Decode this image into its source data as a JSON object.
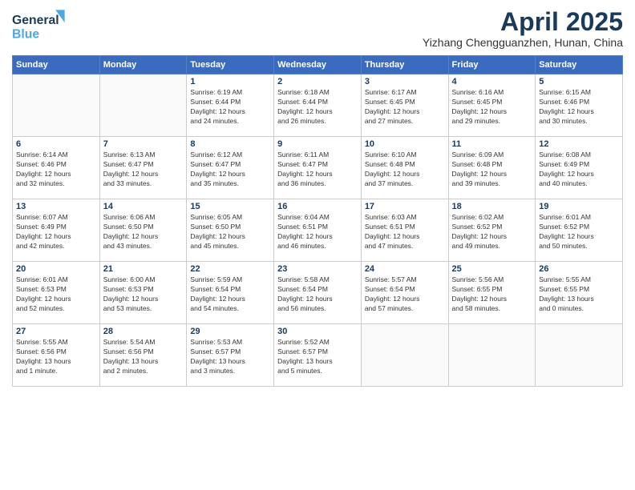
{
  "header": {
    "logo_general": "General",
    "logo_blue": "Blue",
    "month_title": "April 2025",
    "location": "Yizhang Chengguanzhen, Hunan, China"
  },
  "weekdays": [
    "Sunday",
    "Monday",
    "Tuesday",
    "Wednesday",
    "Thursday",
    "Friday",
    "Saturday"
  ],
  "weeks": [
    [
      {
        "num": "",
        "info": ""
      },
      {
        "num": "",
        "info": ""
      },
      {
        "num": "1",
        "info": "Sunrise: 6:19 AM\nSunset: 6:44 PM\nDaylight: 12 hours\nand 24 minutes."
      },
      {
        "num": "2",
        "info": "Sunrise: 6:18 AM\nSunset: 6:44 PM\nDaylight: 12 hours\nand 26 minutes."
      },
      {
        "num": "3",
        "info": "Sunrise: 6:17 AM\nSunset: 6:45 PM\nDaylight: 12 hours\nand 27 minutes."
      },
      {
        "num": "4",
        "info": "Sunrise: 6:16 AM\nSunset: 6:45 PM\nDaylight: 12 hours\nand 29 minutes."
      },
      {
        "num": "5",
        "info": "Sunrise: 6:15 AM\nSunset: 6:46 PM\nDaylight: 12 hours\nand 30 minutes."
      }
    ],
    [
      {
        "num": "6",
        "info": "Sunrise: 6:14 AM\nSunset: 6:46 PM\nDaylight: 12 hours\nand 32 minutes."
      },
      {
        "num": "7",
        "info": "Sunrise: 6:13 AM\nSunset: 6:47 PM\nDaylight: 12 hours\nand 33 minutes."
      },
      {
        "num": "8",
        "info": "Sunrise: 6:12 AM\nSunset: 6:47 PM\nDaylight: 12 hours\nand 35 minutes."
      },
      {
        "num": "9",
        "info": "Sunrise: 6:11 AM\nSunset: 6:47 PM\nDaylight: 12 hours\nand 36 minutes."
      },
      {
        "num": "10",
        "info": "Sunrise: 6:10 AM\nSunset: 6:48 PM\nDaylight: 12 hours\nand 37 minutes."
      },
      {
        "num": "11",
        "info": "Sunrise: 6:09 AM\nSunset: 6:48 PM\nDaylight: 12 hours\nand 39 minutes."
      },
      {
        "num": "12",
        "info": "Sunrise: 6:08 AM\nSunset: 6:49 PM\nDaylight: 12 hours\nand 40 minutes."
      }
    ],
    [
      {
        "num": "13",
        "info": "Sunrise: 6:07 AM\nSunset: 6:49 PM\nDaylight: 12 hours\nand 42 minutes."
      },
      {
        "num": "14",
        "info": "Sunrise: 6:06 AM\nSunset: 6:50 PM\nDaylight: 12 hours\nand 43 minutes."
      },
      {
        "num": "15",
        "info": "Sunrise: 6:05 AM\nSunset: 6:50 PM\nDaylight: 12 hours\nand 45 minutes."
      },
      {
        "num": "16",
        "info": "Sunrise: 6:04 AM\nSunset: 6:51 PM\nDaylight: 12 hours\nand 46 minutes."
      },
      {
        "num": "17",
        "info": "Sunrise: 6:03 AM\nSunset: 6:51 PM\nDaylight: 12 hours\nand 47 minutes."
      },
      {
        "num": "18",
        "info": "Sunrise: 6:02 AM\nSunset: 6:52 PM\nDaylight: 12 hours\nand 49 minutes."
      },
      {
        "num": "19",
        "info": "Sunrise: 6:01 AM\nSunset: 6:52 PM\nDaylight: 12 hours\nand 50 minutes."
      }
    ],
    [
      {
        "num": "20",
        "info": "Sunrise: 6:01 AM\nSunset: 6:53 PM\nDaylight: 12 hours\nand 52 minutes."
      },
      {
        "num": "21",
        "info": "Sunrise: 6:00 AM\nSunset: 6:53 PM\nDaylight: 12 hours\nand 53 minutes."
      },
      {
        "num": "22",
        "info": "Sunrise: 5:59 AM\nSunset: 6:54 PM\nDaylight: 12 hours\nand 54 minutes."
      },
      {
        "num": "23",
        "info": "Sunrise: 5:58 AM\nSunset: 6:54 PM\nDaylight: 12 hours\nand 56 minutes."
      },
      {
        "num": "24",
        "info": "Sunrise: 5:57 AM\nSunset: 6:54 PM\nDaylight: 12 hours\nand 57 minutes."
      },
      {
        "num": "25",
        "info": "Sunrise: 5:56 AM\nSunset: 6:55 PM\nDaylight: 12 hours\nand 58 minutes."
      },
      {
        "num": "26",
        "info": "Sunrise: 5:55 AM\nSunset: 6:55 PM\nDaylight: 13 hours\nand 0 minutes."
      }
    ],
    [
      {
        "num": "27",
        "info": "Sunrise: 5:55 AM\nSunset: 6:56 PM\nDaylight: 13 hours\nand 1 minute."
      },
      {
        "num": "28",
        "info": "Sunrise: 5:54 AM\nSunset: 6:56 PM\nDaylight: 13 hours\nand 2 minutes."
      },
      {
        "num": "29",
        "info": "Sunrise: 5:53 AM\nSunset: 6:57 PM\nDaylight: 13 hours\nand 3 minutes."
      },
      {
        "num": "30",
        "info": "Sunrise: 5:52 AM\nSunset: 6:57 PM\nDaylight: 13 hours\nand 5 minutes."
      },
      {
        "num": "",
        "info": ""
      },
      {
        "num": "",
        "info": ""
      },
      {
        "num": "",
        "info": ""
      }
    ]
  ]
}
